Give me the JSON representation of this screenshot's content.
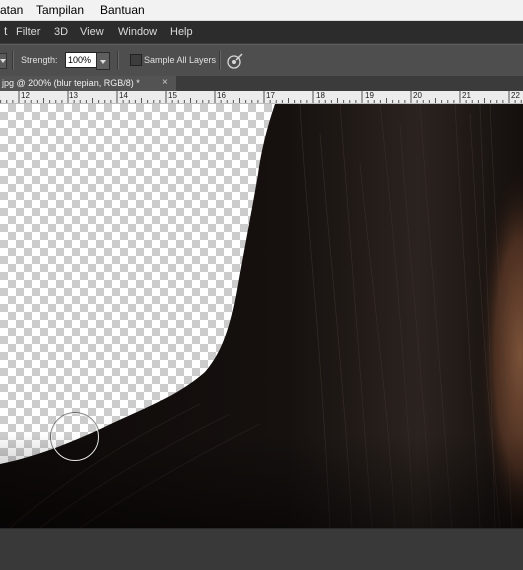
{
  "window_menu": {
    "items": [
      "atan",
      "Tampilan",
      "Bantuan"
    ]
  },
  "app_menu": {
    "items": [
      "Filter",
      "3D",
      "View",
      "Window",
      "Help"
    ]
  },
  "options_bar": {
    "strength_label": "Strength:",
    "strength_value": "100%",
    "sample_all_layers_label": "Sample All Layers",
    "sample_all_layers_checked": false,
    "pressure_icon": "pressure-pen-icon"
  },
  "document_tab": {
    "title": "jpg @ 200% (blur tepian, RGB/8) *",
    "close": "×"
  },
  "ruler": {
    "numbers": [
      "12",
      "13",
      "14",
      "15",
      "16",
      "17",
      "18",
      "19",
      "20",
      "21",
      "22"
    ]
  },
  "colors": {
    "hair": "#0f0b0a",
    "menubar": "#f2f2f2",
    "ps_menubar": "#2c2c2c",
    "options_bar": "#4e4e4e",
    "checker_dark": "#cccccc"
  }
}
